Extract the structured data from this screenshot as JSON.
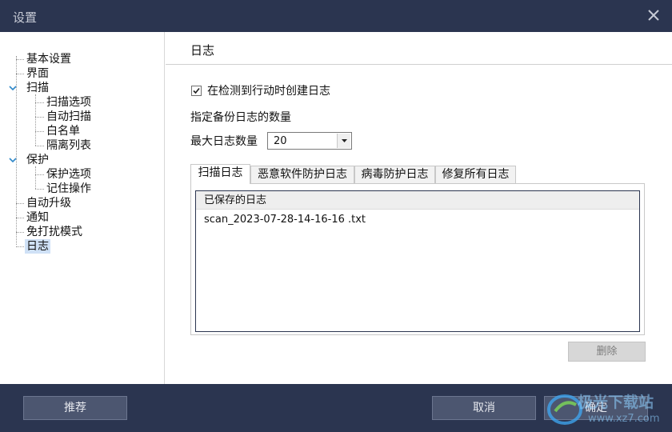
{
  "window": {
    "title": "设置"
  },
  "sidebar": {
    "items": [
      {
        "label": "基本设置"
      },
      {
        "label": "界面"
      },
      {
        "label": "扫描"
      },
      {
        "label": "扫描选项"
      },
      {
        "label": "自动扫描"
      },
      {
        "label": "白名单"
      },
      {
        "label": "隔离列表"
      },
      {
        "label": "保护"
      },
      {
        "label": "保护选项"
      },
      {
        "label": "记住操作"
      },
      {
        "label": "自动升级"
      },
      {
        "label": "通知"
      },
      {
        "label": "免打扰模式"
      },
      {
        "label": "日志"
      }
    ],
    "selected": "日志"
  },
  "main": {
    "title": "日志",
    "create_log_checkbox": {
      "label": "在检测到行动时创建日志",
      "checked": true
    },
    "backup_label": "指定备份日志的数量",
    "max_logs": {
      "label": "最大日志数量",
      "value": "20"
    },
    "tabs": [
      {
        "label": "扫描日志",
        "active": true
      },
      {
        "label": "恶意软件防护日志",
        "active": false
      },
      {
        "label": "病毒防护日志",
        "active": false
      },
      {
        "label": "修复所有日志",
        "active": false
      }
    ],
    "list": {
      "header": "已保存的日志",
      "rows": [
        "scan_2023-07-28-14-16-16 .txt"
      ]
    },
    "delete_label": "删除"
  },
  "footer": {
    "recommend_label": "推荐",
    "cancel_label": "取消",
    "ok_label": "确定"
  },
  "watermark": {
    "text": "极光下载站",
    "url": "www.xz7.com"
  },
  "colors": {
    "titlebar": "#2b3550",
    "footer": "#2b3550",
    "selected_bg": "#cfe1f6",
    "expander": "#2f88c9"
  }
}
